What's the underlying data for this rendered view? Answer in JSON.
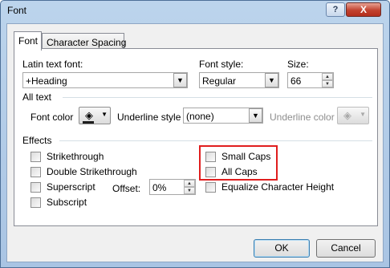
{
  "window": {
    "title": "Font",
    "help_label": "?",
    "close_label": "X"
  },
  "tabs": [
    {
      "label": "Font",
      "active": true
    },
    {
      "label": "Character Spacing",
      "active": false
    }
  ],
  "latin_font": {
    "label": "Latin text font:",
    "value": "+Heading"
  },
  "font_style": {
    "label": "Font style:",
    "value": "Regular"
  },
  "size": {
    "label": "Size:",
    "value": "66"
  },
  "all_text": {
    "section_label": "All text",
    "font_color_label": "Font color",
    "underline_style_label": "Underline style",
    "underline_style_value": "(none)",
    "underline_color_label": "Underline color"
  },
  "effects": {
    "section_label": "Effects",
    "strikethrough": "Strikethrough",
    "double_strikethrough": "Double Strikethrough",
    "superscript": "Superscript",
    "subscript": "Subscript",
    "offset_label": "Offset:",
    "offset_value": "0%",
    "small_caps": "Small Caps",
    "all_caps": "All Caps",
    "equalize_height": "Equalize Character Height"
  },
  "buttons": {
    "ok": "OK",
    "cancel": "Cancel"
  },
  "colors": {
    "highlight_box": "#e01e1e",
    "font_color_bar": "#1e1e1e"
  },
  "icons": {
    "font_color": "paint-bucket-icon",
    "underline_color": "paint-bucket-icon"
  }
}
